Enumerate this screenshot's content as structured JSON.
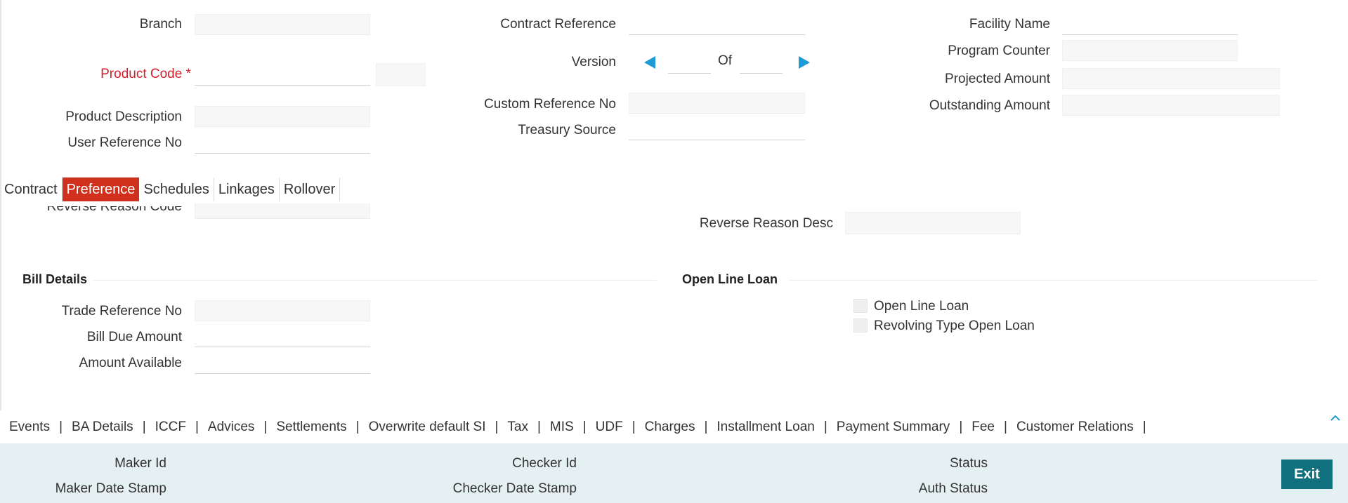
{
  "header": {
    "branch_label": "Branch",
    "product_code_label": "Product Code",
    "required_marker": "*",
    "product_description_label": "Product Description",
    "user_reference_label": "User Reference No",
    "contract_reference_label": "Contract Reference",
    "version_label": "Version",
    "version_of": "Of",
    "custom_reference_label": "Custom Reference No",
    "treasury_source_label": "Treasury Source",
    "facility_name_label": "Facility Name",
    "program_counter_label": "Program Counter",
    "projected_amount_label": "Projected Amount",
    "outstanding_amount_label": "Outstanding Amount"
  },
  "tabs": [
    {
      "label": "Contract"
    },
    {
      "label": "Preference",
      "active": true
    },
    {
      "label": "Schedules"
    },
    {
      "label": "Linkages"
    },
    {
      "label": "Rollover"
    }
  ],
  "preference": {
    "reverse_reason_code_label": "Reverse Reason Code",
    "reverse_reason_desc_label": "Reverse Reason Desc"
  },
  "bill_details": {
    "title": "Bill Details",
    "trade_reference_label": "Trade Reference No",
    "bill_due_amount_label": "Bill Due Amount",
    "amount_available_label": "Amount Available"
  },
  "open_line_loan": {
    "title": "Open Line Loan",
    "open_line_loan_label": "Open Line Loan",
    "revolving_label": "Revolving Type Open Loan"
  },
  "bottom_links": [
    "Events",
    "BA Details",
    "ICCF",
    "Advices",
    "Settlements",
    "Overwrite default SI",
    "Tax",
    "MIS",
    "UDF",
    "Charges",
    "Installment Loan",
    "Payment Summary",
    "Fee",
    "Customer Relations"
  ],
  "footer": {
    "maker_id_label": "Maker Id",
    "maker_date_label": "Maker Date Stamp",
    "checker_id_label": "Checker Id",
    "checker_date_label": "Checker Date Stamp",
    "status_label": "Status",
    "auth_status_label": "Auth Status",
    "exit_label": "Exit"
  },
  "colors": {
    "required": "#d51e2b",
    "active_tab": "#d0311e",
    "nav_arrow": "#1d9bd7",
    "footer_bg": "#e5f0f2",
    "exit_button": "#11707e"
  },
  "icons": {
    "prev": "triangle-left-icon",
    "next": "triangle-right-icon",
    "collapse": "chevron-up-icon"
  }
}
